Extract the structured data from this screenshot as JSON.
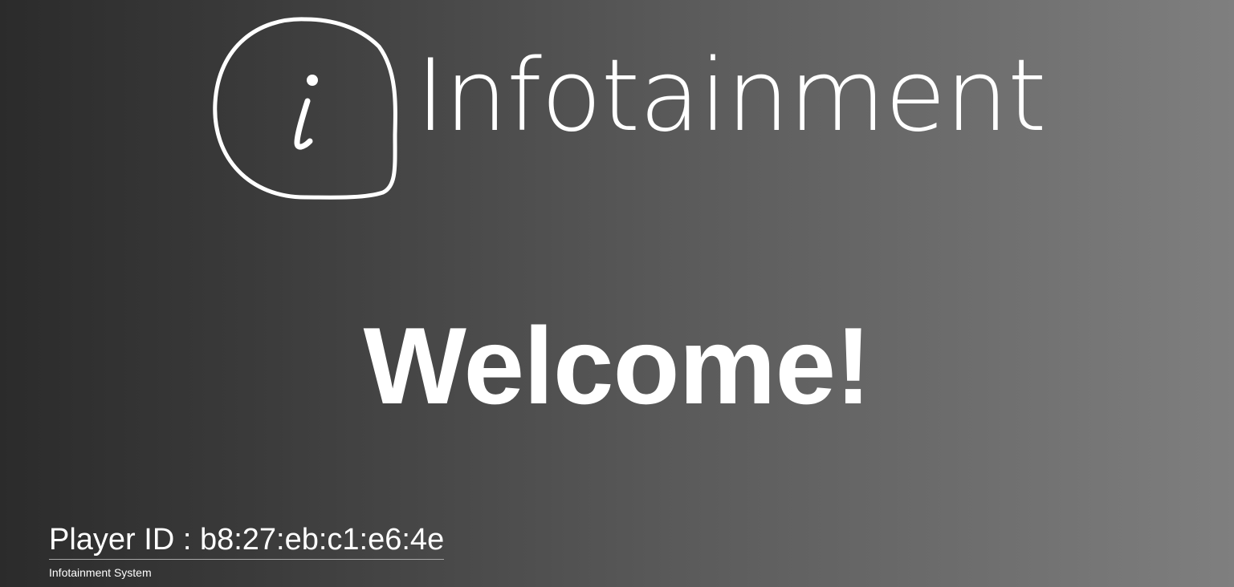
{
  "logo": {
    "icon": "info-i-icon",
    "wordmark": "Infotainment"
  },
  "main": {
    "welcome_text": "Welcome!"
  },
  "footer": {
    "player_id_label": "Player ID : b8:27:eb:c1:e6:4e",
    "system_name": "Infotainment System"
  },
  "colors": {
    "background_start": "#2b2b2b",
    "background_end": "#7f7f7f",
    "text": "#ffffff"
  }
}
